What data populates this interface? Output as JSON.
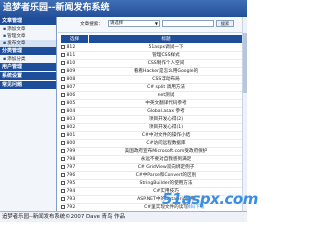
{
  "header": {
    "title": "追梦者乐园--新闻发布系统"
  },
  "sidebar": {
    "sections": [
      {
        "label": "文章管理",
        "items": [
          "添加文章",
          "管理文章",
          "发布文章"
        ]
      },
      {
        "label": "分类管理",
        "items": [
          "添加分类"
        ]
      },
      {
        "label": "用户管理",
        "items": []
      },
      {
        "label": "系统设置",
        "items": []
      },
      {
        "label": "常见问题",
        "items": []
      }
    ]
  },
  "filter": {
    "label": "文章搜索：",
    "selected": "请选择",
    "button": "搜索"
  },
  "table": {
    "headers": [
      "选择",
      "标题"
    ],
    "rows": [
      {
        "id": "812",
        "title": "51aspx调试一下"
      },
      {
        "id": "811",
        "title": "管理CSS样式"
      },
      {
        "id": "810",
        "title": "CSS制作个人空间"
      },
      {
        "id": "809",
        "title": "看看Hacker是怎么用Google的"
      },
      {
        "id": "808",
        "title": "CSS浮动布局"
      },
      {
        "id": "807",
        "title": "C# split 调用方法"
      },
      {
        "id": "806",
        "title": "net测试"
      },
      {
        "id": "805",
        "title": "中英文翻译代码参考"
      },
      {
        "id": "804",
        "title": "Global.asax 参考"
      },
      {
        "id": "803",
        "title": "项目开发心得(2)"
      },
      {
        "id": "802",
        "title": "项目开发心得(1)"
      },
      {
        "id": "801",
        "title": "C#中对文件的操作小结"
      },
      {
        "id": "800",
        "title": "C#访问远程数据库"
      },
      {
        "id": "799",
        "title": "美国政府宣布Microsoft.com受政府保护"
      },
      {
        "id": "798",
        "title": "永远不要对自我感到满足"
      },
      {
        "id": "797",
        "title": "C# GridView双向绑定例子"
      },
      {
        "id": "796",
        "title": "C#中Parse和Convert的区别"
      },
      {
        "id": "795",
        "title": "StringBuilder的使用方法"
      },
      {
        "id": "794",
        "title": "C#实用技巧"
      },
      {
        "id": "793",
        "title": "ASP.NET中的DataGrid使用"
      },
      {
        "id": "792",
        "title": "C#里实现文件的读写"
      }
    ]
  },
  "status": {
    "text": "追梦者乐园--新闻发布系统©2007 Dave 青鸟 作品"
  },
  "watermark": {
    "main": "51aspx.com",
    "sub": "源码下载"
  },
  "colors": {
    "header": "#234f99",
    "section": "#1e4d9a",
    "watermark": "#3a8de0"
  }
}
